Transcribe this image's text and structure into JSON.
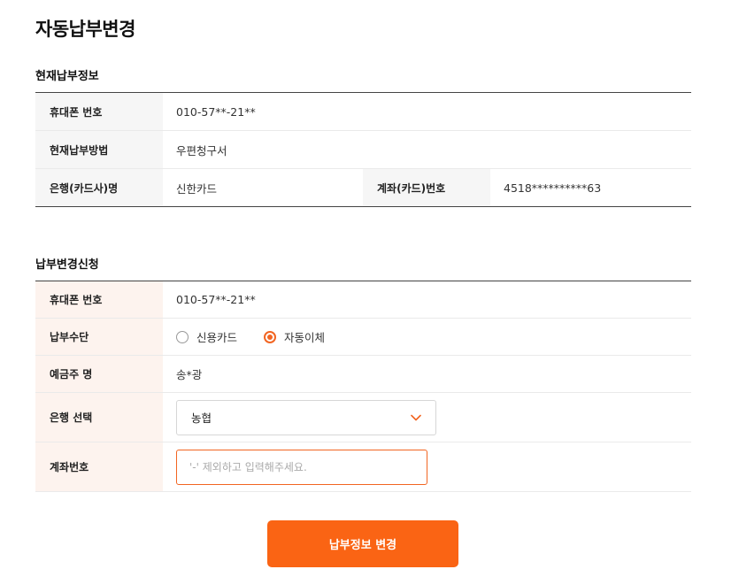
{
  "page_title": "자동납부변경",
  "current_info": {
    "section_title": "현재납부정보",
    "phone_label": "휴대폰 번호",
    "phone_value": "010-57**-21**",
    "method_label": "현재납부방법",
    "method_value": "우편청구서",
    "bank_label": "은행(카드사)명",
    "bank_value": "신한카드",
    "account_label": "계좌(카드)번호",
    "account_value": "4518**********63"
  },
  "change_request": {
    "section_title": "납부변경신청",
    "phone_label": "휴대폰 번호",
    "phone_value": "010-57**-21**",
    "payment_means_label": "납부수단",
    "options": [
      {
        "label": "신용카드",
        "selected": false
      },
      {
        "label": "자동이체",
        "selected": true
      }
    ],
    "holder_label": "예금주 명",
    "holder_value": "송*광",
    "bank_select_label": "은행 선택",
    "bank_select_value": "농협",
    "account_label": "계좌번호",
    "account_placeholder": "'-' 제외하고 입력해주세요.",
    "account_value": ""
  },
  "submit_label": "납부정보 변경",
  "colors": {
    "accent": "#fa6414",
    "radio_accent": "#f26522",
    "label_bg_current": "#f6f6f6",
    "label_bg_request": "#fdf3ee"
  },
  "icons": {
    "select_arrow": "chevron-down-icon"
  }
}
